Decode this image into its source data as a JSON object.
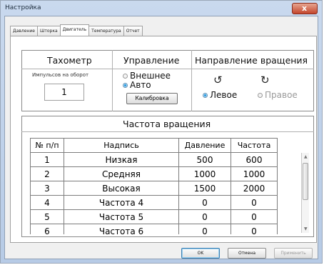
{
  "window": {
    "title": "Настройка"
  },
  "tabs": [
    {
      "label": "Давление",
      "active": false
    },
    {
      "label": "Шторка",
      "active": false
    },
    {
      "label": "Двигатель",
      "active": true
    },
    {
      "label": "Температура",
      "active": false
    },
    {
      "label": "Отчет",
      "active": false
    }
  ],
  "tachometer": {
    "title": "Тахометр",
    "pulses_label": "Импульсов на оборот",
    "pulses_value": "1"
  },
  "control": {
    "title": "Управление",
    "options": [
      {
        "label": "Внешнее",
        "selected": false
      },
      {
        "label": "Авто",
        "selected": true
      }
    ],
    "calibrate_label": "Калибровка"
  },
  "direction": {
    "title": "Направление вращения",
    "left_icon": "rotate-ccw-icon",
    "right_icon": "rotate-cw-icon",
    "options": [
      {
        "label": "Левое",
        "selected": true
      },
      {
        "label": "Правое",
        "selected": false
      }
    ]
  },
  "speed": {
    "title": "Частота вращения",
    "columns": [
      "№ п/п",
      "Надпись",
      "Давление",
      "Частота"
    ],
    "rows": [
      [
        "1",
        "Низкая",
        "500",
        "600"
      ],
      [
        "2",
        "Средняя",
        "1000",
        "1000"
      ],
      [
        "3",
        "Высокая",
        "1500",
        "2000"
      ],
      [
        "4",
        "Частота 4",
        "0",
        "0"
      ],
      [
        "5",
        "Частота 5",
        "0",
        "0"
      ],
      [
        "6",
        "Частота 6",
        "0",
        "0"
      ]
    ]
  },
  "buttons": {
    "ok": "OK",
    "cancel": "Отмена",
    "apply": "Применить"
  },
  "colors": {
    "accent": "#2f9ee3",
    "close_button": "#c4462c"
  }
}
